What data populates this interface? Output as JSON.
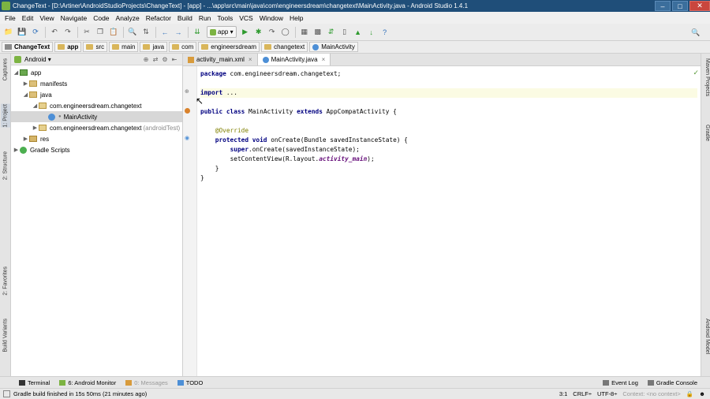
{
  "window": {
    "title": "ChangeText - [D:\\Artiner\\AndroidStudioProjects\\ChangeText] - [app] - ...\\app\\src\\main\\java\\com\\engineersdream\\changetext\\MainActivity.java - Android Studio 1.4.1"
  },
  "menu": [
    "File",
    "Edit",
    "View",
    "Navigate",
    "Code",
    "Analyze",
    "Refactor",
    "Build",
    "Run",
    "Tools",
    "VCS",
    "Window",
    "Help"
  ],
  "toolbar": {
    "run_config": "app"
  },
  "breadcrumb": [
    "ChangeText",
    "app",
    "src",
    "main",
    "java",
    "com",
    "engineersdream",
    "changetext",
    "MainActivity"
  ],
  "left_strip": {
    "captures": "Captures",
    "project": "1: Project",
    "structure": "2: Structure",
    "favorites": "2: Favorites",
    "build_variants": "Build Variants"
  },
  "right_strip": {
    "maven": "Maven Projects",
    "gradle": "Gradle",
    "android_model": "Android Model"
  },
  "project_panel": {
    "view_selector": "Android",
    "tree": [
      {
        "label": "app",
        "level": 0,
        "expanded": true,
        "icon": "module-icon"
      },
      {
        "label": "manifests",
        "level": 1,
        "expanded": false,
        "icon": "folder-icon"
      },
      {
        "label": "java",
        "level": 1,
        "expanded": true,
        "icon": "folder-icon"
      },
      {
        "label": "com.engineersdream.changetext",
        "level": 2,
        "expanded": true,
        "icon": "package-icon"
      },
      {
        "label": "MainActivity",
        "level": 3,
        "expanded": null,
        "icon": "class-icon",
        "selected": true
      },
      {
        "label": "com.engineersdream.changetext",
        "suffix": "(androidTest)",
        "level": 2,
        "expanded": false,
        "icon": "package-icon"
      },
      {
        "label": "res",
        "level": 1,
        "expanded": false,
        "icon": "res-folder-icon"
      },
      {
        "label": "Gradle Scripts",
        "level": 0,
        "expanded": false,
        "icon": "gradle-icon"
      }
    ]
  },
  "editor_tabs": [
    {
      "label": "activity_main.xml",
      "active": false
    },
    {
      "label": "MainActivity.java",
      "active": true
    }
  ],
  "code": {
    "package_kw": "package",
    "package_name": " com.engineersdream.changetext;",
    "import_kw": "import",
    "import_rest": " ...",
    "class_kw": "public class",
    "class_name": " MainActivity ",
    "extends_kw": "extends",
    "super_class": " AppCompatActivity {",
    "annotation": "@Override",
    "method_kw": "protected void",
    "method_sig": " onCreate(Bundle savedInstanceState) {",
    "super_kw": "super",
    "super_call": ".onCreate(savedInstanceState);",
    "set_content_pre": "setContentView(R.layout.",
    "set_content_field": "activity_main",
    "set_content_post": ");",
    "close_method": "}",
    "close_class": "}"
  },
  "bottom_tabs": {
    "terminal": "Terminal",
    "android_monitor": "6: Android Monitor",
    "messages": "0: Messages",
    "todo": "TODO",
    "event_log": "Event Log",
    "gradle_console": "Gradle Console"
  },
  "status": {
    "message": "Gradle build finished in 15s 50ms (21 minutes ago)",
    "position": "3:1",
    "line_sep": "CRLF÷",
    "encoding": "UTF-8÷",
    "context": "Context: <no context>"
  }
}
